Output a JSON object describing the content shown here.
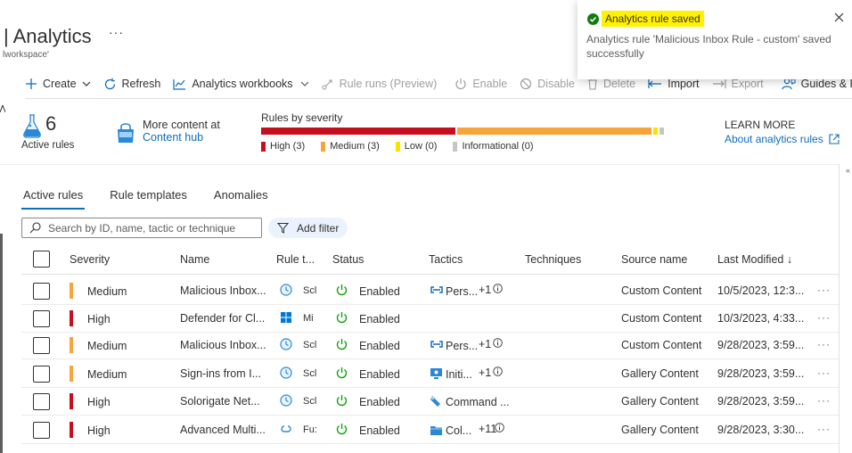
{
  "header": {
    "title": "| Analytics",
    "more": "···",
    "subtitle": "lworkspace'"
  },
  "toolbar": {
    "create": "Create",
    "refresh": "Refresh",
    "workbooks": "Analytics workbooks",
    "rule_runs": "Rule runs (Preview)",
    "enable": "Enable",
    "disable": "Disable",
    "delete": "Delete",
    "import": "Import",
    "export": "Export",
    "guides": "Guides & Feedb"
  },
  "summary": {
    "active_count": "6",
    "active_label": "Active rules",
    "hub_line1": "More content at",
    "hub_line2": "Content hub",
    "severity_title": "Rules by severity",
    "severity": [
      {
        "label": "High (3)",
        "value": 3,
        "color": "#c50f1f"
      },
      {
        "label": "Medium (3)",
        "value": 3,
        "color": "#f7a53b"
      },
      {
        "label": "Low (0)",
        "value": 0,
        "color": "#fce100"
      },
      {
        "label": "Informational (0)",
        "value": 0,
        "color": "#c8c6c4"
      }
    ],
    "learn_more": "LEARN MORE",
    "learn_link": "About analytics rules"
  },
  "tabs": [
    "Active rules",
    "Rule templates",
    "Anomalies"
  ],
  "search": {
    "placeholder": "Search by ID, name, tactic or technique"
  },
  "filter": {
    "label": "Add filter"
  },
  "columns": [
    "Severity",
    "Name",
    "Rule t...",
    "Status",
    "Tactics",
    "Techniques",
    "Source name",
    "Last Modified ↓"
  ],
  "rows": [
    {
      "severity": "Medium",
      "sev_color": "#f7a53b",
      "name": "Malicious Inbox...",
      "rule_type": "Scl",
      "type_icon": "clock-icon",
      "status": "Enabled",
      "tactic": "Pers...",
      "tactic_icon": "persistence-icon",
      "extra": "+1",
      "source": "Custom Content",
      "modified": "10/5/2023, 12:3..."
    },
    {
      "severity": "High",
      "sev_color": "#c50f1f",
      "name": "Defender for Cl...",
      "rule_type": "Mi",
      "type_icon": "microsoft-icon",
      "status": "Enabled",
      "tactic": "",
      "tactic_icon": "",
      "extra": "",
      "source": "Custom Content",
      "modified": "10/3/2023, 4:33..."
    },
    {
      "severity": "Medium",
      "sev_color": "#f7a53b",
      "name": "Malicious Inbox...",
      "rule_type": "Scl",
      "type_icon": "clock-icon",
      "status": "Enabled",
      "tactic": "Pers...",
      "tactic_icon": "persistence-icon",
      "extra": "+1",
      "source": "Custom Content",
      "modified": "9/28/2023, 3:59..."
    },
    {
      "severity": "Medium",
      "sev_color": "#f7a53b",
      "name": "Sign-ins from I...",
      "rule_type": "Scl",
      "type_icon": "clock-icon",
      "status": "Enabled",
      "tactic": "Initi...",
      "tactic_icon": "initial-access-icon",
      "extra": "+1",
      "source": "Gallery Content",
      "modified": "9/28/2023, 3:59..."
    },
    {
      "severity": "High",
      "sev_color": "#c50f1f",
      "name": "Solorigate Net...",
      "rule_type": "Scl",
      "type_icon": "clock-icon",
      "status": "Enabled",
      "tactic": "Command ...",
      "tactic_icon": "command-control-icon",
      "extra": "",
      "source": "Gallery Content",
      "modified": "9/28/2023, 3:59..."
    },
    {
      "severity": "High",
      "sev_color": "#c50f1f",
      "name": "Advanced Multi...",
      "rule_type": "Fu:",
      "type_icon": "fusion-icon",
      "status": "Enabled",
      "tactic": "Col...",
      "tactic_icon": "collection-icon",
      "extra": "+11",
      "source": "Gallery Content",
      "modified": "9/28/2023, 3:30..."
    }
  ],
  "toast": {
    "title": "Analytics rule saved",
    "message": "Analytics rule 'Malicious Inbox Rule - custom' saved successfully"
  }
}
